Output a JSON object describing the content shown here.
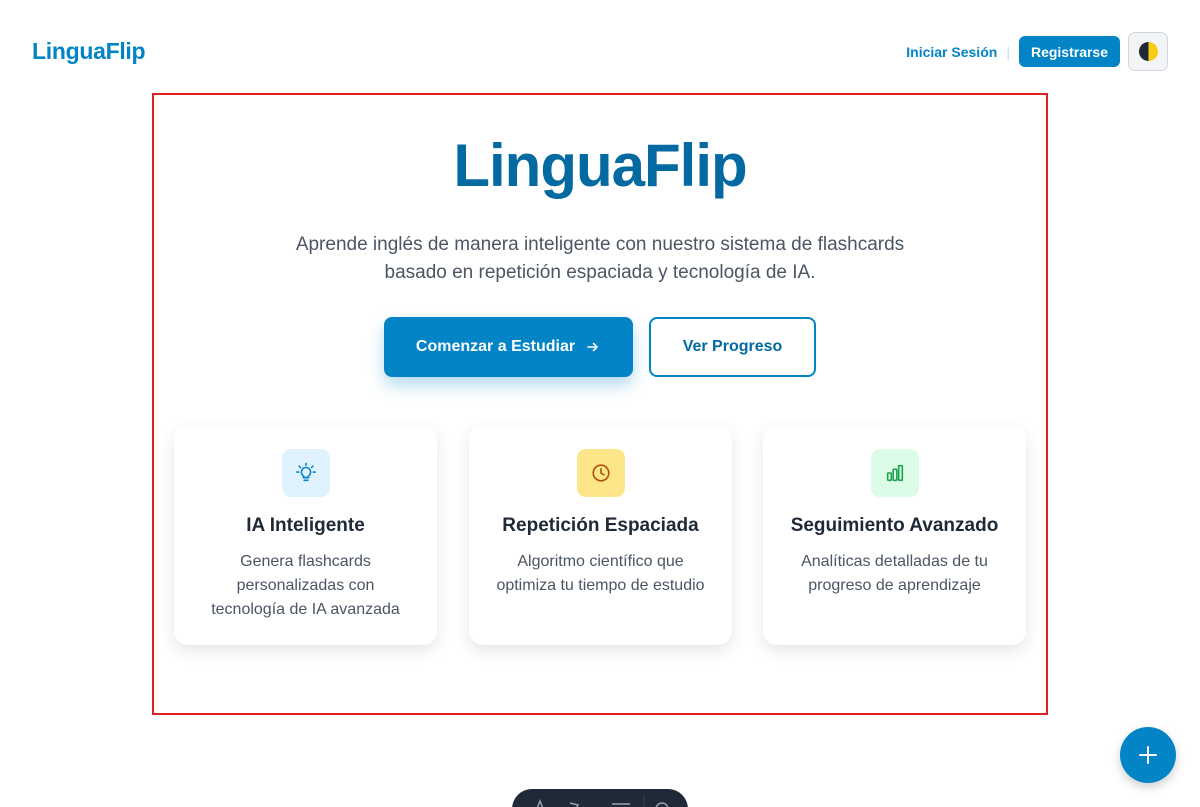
{
  "header": {
    "logo": "LinguaFlip",
    "login": "Iniciar Sesión",
    "separator": "|",
    "register": "Registrarse",
    "theme_icon": "half-moon-icon"
  },
  "hero": {
    "title": "LinguaFlip",
    "subtitle": "Aprende inglés de manera inteligente con nuestro sistema de flashcards basado en repetición espaciada y tecnología de IA.",
    "cta_primary": "Comenzar a Estudiar",
    "cta_primary_icon": "arrow-right-icon",
    "cta_secondary": "Ver Progreso"
  },
  "features": [
    {
      "icon": "lightbulb-icon",
      "icon_bg": "#e0f2fe",
      "icon_color": "#0284c7",
      "title": "IA Inteligente",
      "desc": "Genera flashcards personalizadas con tecnología de IA avanzada"
    },
    {
      "icon": "clock-icon",
      "icon_bg": "#fde68a",
      "icon_color": "#b45309",
      "title": "Repetición Espaciada",
      "desc": "Algoritmo científico que optimiza tu tiempo de estudio"
    },
    {
      "icon": "bar-chart-icon",
      "icon_bg": "#dcfce7",
      "icon_color": "#16a34a",
      "title": "Seguimiento Avanzado",
      "desc": "Analíticas detalladas de tu progreso de aprendizaje"
    }
  ],
  "fab": {
    "icon": "plus-icon"
  },
  "colors": {
    "primary": "#0284c7",
    "primary_dark": "#0369a1",
    "outline": "#e11d1d"
  }
}
